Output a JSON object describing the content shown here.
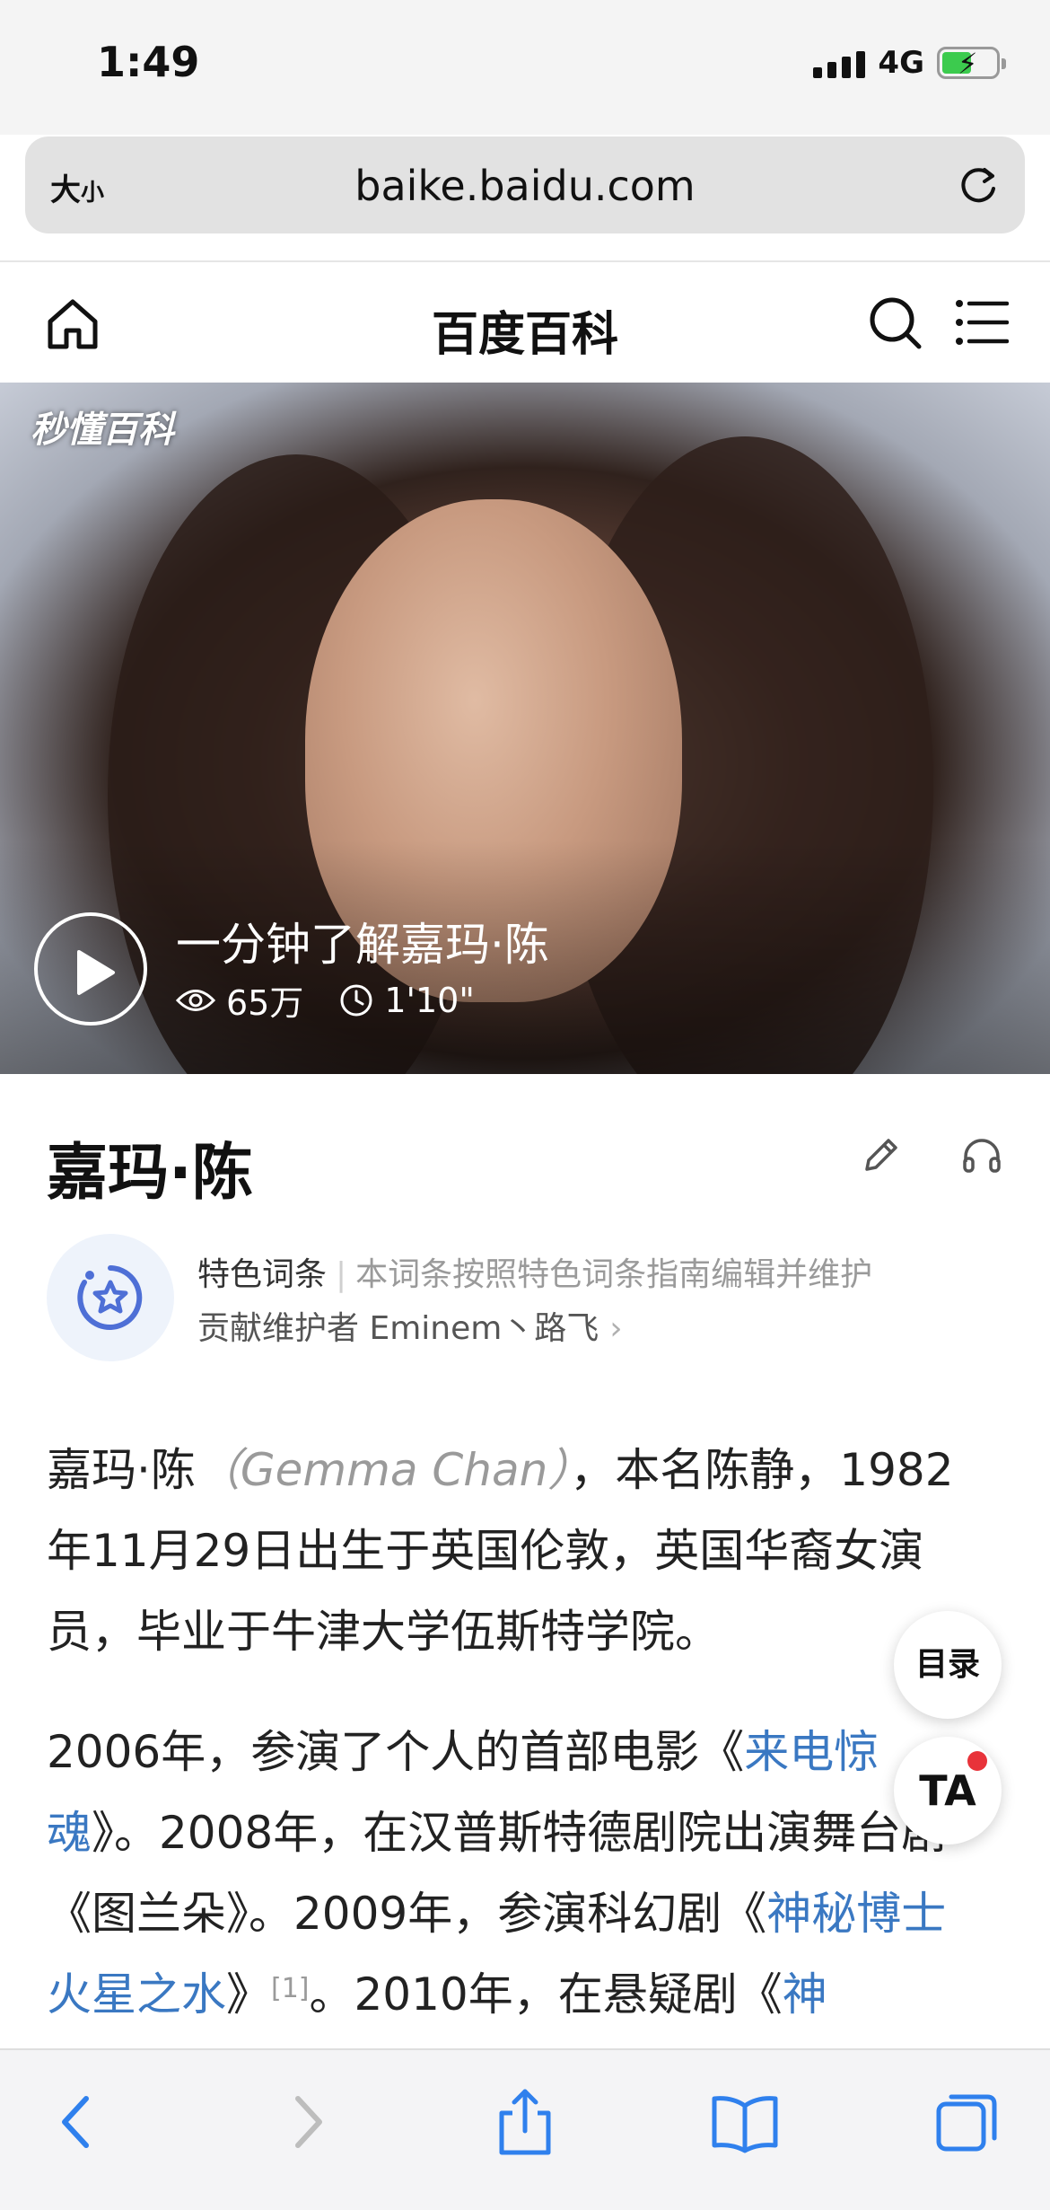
{
  "status_bar": {
    "time": "1:49",
    "network": "4G"
  },
  "url_bar": {
    "text_size_big": "大",
    "text_size_small": "小",
    "url": "baike.baidu.com"
  },
  "site_header": {
    "title": "百度百科"
  },
  "hero_video": {
    "watermark": "秒懂百科",
    "title": "一分钟了解嘉玛·陈",
    "views": "65万",
    "duration": "1'10\""
  },
  "entry": {
    "title": "嘉玛·陈",
    "featured_label": "特色词条",
    "featured_desc": "本词条按照特色词条指南编辑并维护",
    "contributors": "贡献维护者 Eminem丶路飞",
    "paragraphs": [
      {
        "text_before": "嘉玛·陈",
        "latin": "（Gemma Chan）",
        "text_after": "，本名陈静，1982年11月29日出生于英国伦敦，英国华裔女演员，毕业于牛津大学伍斯特学院。"
      },
      {
        "t1": "2006年，参演了个人的首部电影《",
        "link1": "来电惊魂",
        "t2": "》。2008年，在汉普斯特德剧院出演舞台剧《图兰朵》。2009年，参演科幻剧《",
        "link2": "神秘博士火星之水",
        "t3": "》",
        "ref": "[1]",
        "t4": "。2010年，在悬疑剧《",
        "link3": "神"
      }
    ]
  },
  "floating": {
    "toc": "目录",
    "ta": "TA"
  },
  "colors": {
    "link": "#3a78c2",
    "toolbar_icon": "#2f80ed",
    "notification_dot": "#e8333a"
  }
}
